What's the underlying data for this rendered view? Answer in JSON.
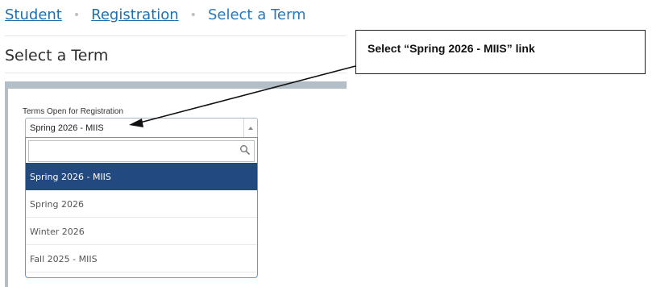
{
  "breadcrumb": {
    "items": [
      "Student",
      "Registration"
    ],
    "current": "Select a Term",
    "separator": "•"
  },
  "page": {
    "title": "Select a Term"
  },
  "terms_field": {
    "label": "Terms Open for Registration",
    "selected_value": "Spring 2026 - MIIS",
    "search_placeholder": ""
  },
  "dropdown": {
    "options": [
      "Spring 2026 - MIIS",
      "Spring 2026",
      "Winter 2026",
      "Fall 2025 - MIIS"
    ],
    "highlighted_index": 0
  },
  "callout": {
    "text": "Select “Spring 2026 - MIIS” link"
  },
  "colors": {
    "link": "#1f6fae",
    "highlight": "#234a80",
    "panel_bar": "#b4bec7",
    "focus_border": "#5b9bd5"
  },
  "icons": {
    "search": "magnifier-icon",
    "caret": "caret-up-icon"
  }
}
